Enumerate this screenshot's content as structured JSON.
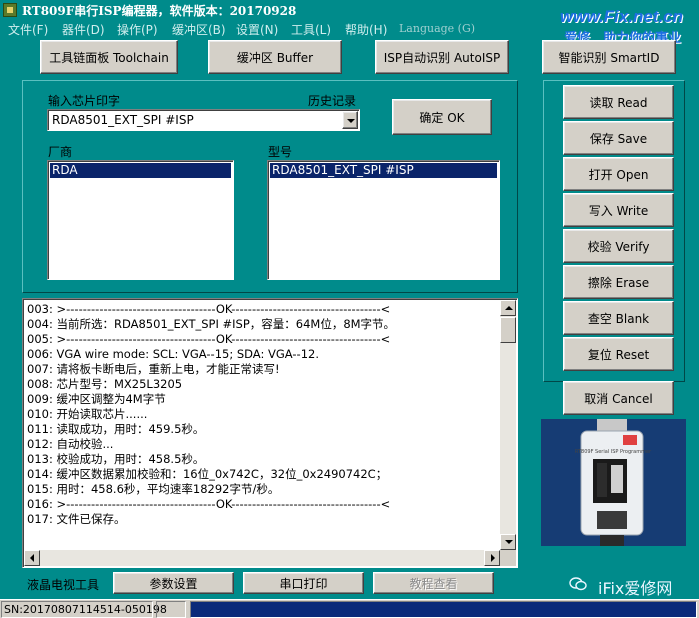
{
  "window": {
    "title": "RT809F串行ISP编程器，软件版本：20170928"
  },
  "menu": [
    "文件(F)",
    "器件(D)",
    "操作(P)",
    "缓冲区(B)",
    "设置(N)",
    "工具(L)",
    "帮助(H)",
    "Language (G)"
  ],
  "watermark": {
    "url": "www.Fix.net.cn",
    "slogan": "爱修．助力你的事业"
  },
  "toolbar": {
    "toolchain": "工具链面板 Toolchain",
    "buffer": "缓冲区 Buffer",
    "autoisp": "ISP自动识别 AutoISP",
    "smartid": "智能识别 SmartID"
  },
  "chip": {
    "input_label": "输入芯片印字",
    "history_label": "历史记录",
    "input_value": "RDA8501_EXT_SPI #ISP",
    "ok_button": "确定 OK",
    "vendor_label": "厂商",
    "model_label": "型号",
    "vendors": [
      "RDA"
    ],
    "models": [
      "RDA8501_EXT_SPI #ISP"
    ]
  },
  "actions": {
    "read": "读取 Read",
    "save": "保存 Save",
    "open": "打开 Open",
    "write": "写入 Write",
    "verify": "校验 Verify",
    "erase": "擦除 Erase",
    "blank": "查空 Blank",
    "reset": "复位 Reset",
    "cancel": "取消 Cancel"
  },
  "log": [
    "003: >------------------------------------OK------------------------------------<",
    "004: 当前所选：RDA8501_EXT_SPI #ISP，容量：64M位，8M字节。",
    "005: >------------------------------------OK------------------------------------<",
    "006: VGA wire mode: SCL: VGA--15; SDA: VGA--12.",
    "007: 请将板卡断电后，重新上电，才能正常读写!",
    "008: 芯片型号：MX25L3205",
    "009: 缓冲区调整为4M字节",
    "010: 开始读取芯片......",
    "011: 读取成功，用时：459.5秒。",
    "012: 自动校验...",
    "013: 校验成功，用时：458.5秒。",
    "014: 缓冲区数据累加校验和：16位_0x742C，32位_0x2490742C；",
    "015: 用时：458.6秒，平均速率18292字节/秒。",
    "016: >------------------------------------OK------------------------------------<",
    "017: 文件已保存。"
  ],
  "bottom_tabs": {
    "lcd_tool": "液晶电视工具",
    "params": "参数设置",
    "serial_print": "串口打印",
    "tutorial": "教程查看"
  },
  "device": {
    "label": "RT809F Serial ISP Programmer"
  },
  "wechat": {
    "label": "iFix爱修网"
  },
  "status": {
    "serial": "SN:20170807114514-050198"
  }
}
